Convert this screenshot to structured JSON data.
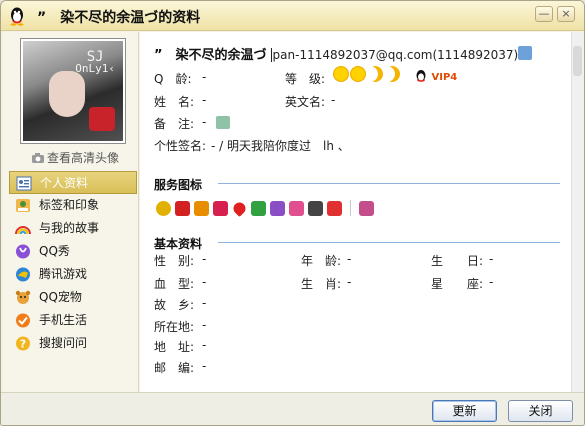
{
  "window": {
    "title": "”　染不尽的余温づ的资料",
    "min_label": "—",
    "close_label": "×"
  },
  "profile": {
    "avatar_text_line1": "SJ",
    "avatar_text_line2": "OnLy1‹",
    "hd_avatar_link": "查看高清头像",
    "nickname": "”　染不尽的余温づ",
    "account": "pan-1114892037@qq.com(1114892037)",
    "qage_label": "Q　龄:",
    "qage_value": "-",
    "level_label": "等　级:",
    "level_icons": [
      "sun-icon",
      "sun-icon",
      "moon-icon",
      "moon-icon"
    ],
    "vip_label": "VIP4",
    "name_label": "姓　名:",
    "name_value": "-",
    "eng_name_label": "英文名:",
    "eng_name_value": "-",
    "remark_label": "备　注:",
    "remark_value": "-",
    "signature_label": "个性签名:",
    "signature_value": "- / 明天我陪你度过　lh 、"
  },
  "nav": {
    "items": [
      {
        "label": "个人资料",
        "icon": "profile-card-icon",
        "active": true
      },
      {
        "label": "标签和印象",
        "icon": "tag-icon",
        "active": false
      },
      {
        "label": "与我的故事",
        "icon": "rainbow-icon",
        "active": false
      },
      {
        "label": "QQ秀",
        "icon": "qqshow-icon",
        "active": false
      },
      {
        "label": "腾讯游戏",
        "icon": "game-icon",
        "active": false
      },
      {
        "label": "QQ宠物",
        "icon": "pet-icon",
        "active": false
      },
      {
        "label": "手机生活",
        "icon": "phone-check-icon",
        "active": false
      },
      {
        "label": "搜搜问问",
        "icon": "question-icon",
        "active": false
      }
    ]
  },
  "services": {
    "title": "服务图标",
    "icons": [
      "diamond-yellow-icon",
      "penguin-icon",
      "diamond-orange-icon",
      "diamond-red-icon",
      "heart-icon",
      "diamond-green-icon",
      "diamond-purple-icon",
      "diamond-pink-icon",
      "diamond-black-icon",
      "star-icon",
      "heart-purple-icon"
    ],
    "colors": [
      "#e0b100",
      "#d32020",
      "#e88d00",
      "#d6204f",
      "#e0201f",
      "#30a040",
      "#8a4fc4",
      "#e0508f",
      "#444444",
      "#e03030",
      "#c44d8c"
    ]
  },
  "basic": {
    "title": "基本资料",
    "gender_label": "性　别:",
    "gender_value": "-",
    "age_label": "年　龄:",
    "age_value": "-",
    "birthday_label": "生　　日:",
    "birthday_value": "-",
    "blood_label": "血　型:",
    "blood_value": "-",
    "zodiac_label": "生　肖:",
    "zodiac_value": "-",
    "constellation_label": "星　　座:",
    "constellation_value": "-",
    "hometown_label": "故　乡:",
    "hometown_value": "-",
    "location_label": "所在地:",
    "location_value": "-",
    "address_label": "地　址:",
    "address_value": "-",
    "postcode_label": "邮　编:",
    "postcode_value": "-"
  },
  "buttons": {
    "refresh": "更新",
    "close": "关闭"
  },
  "colors": {
    "accent": "#d8bf56",
    "section_line": "#8fb2da",
    "vip": "#e04a00"
  }
}
